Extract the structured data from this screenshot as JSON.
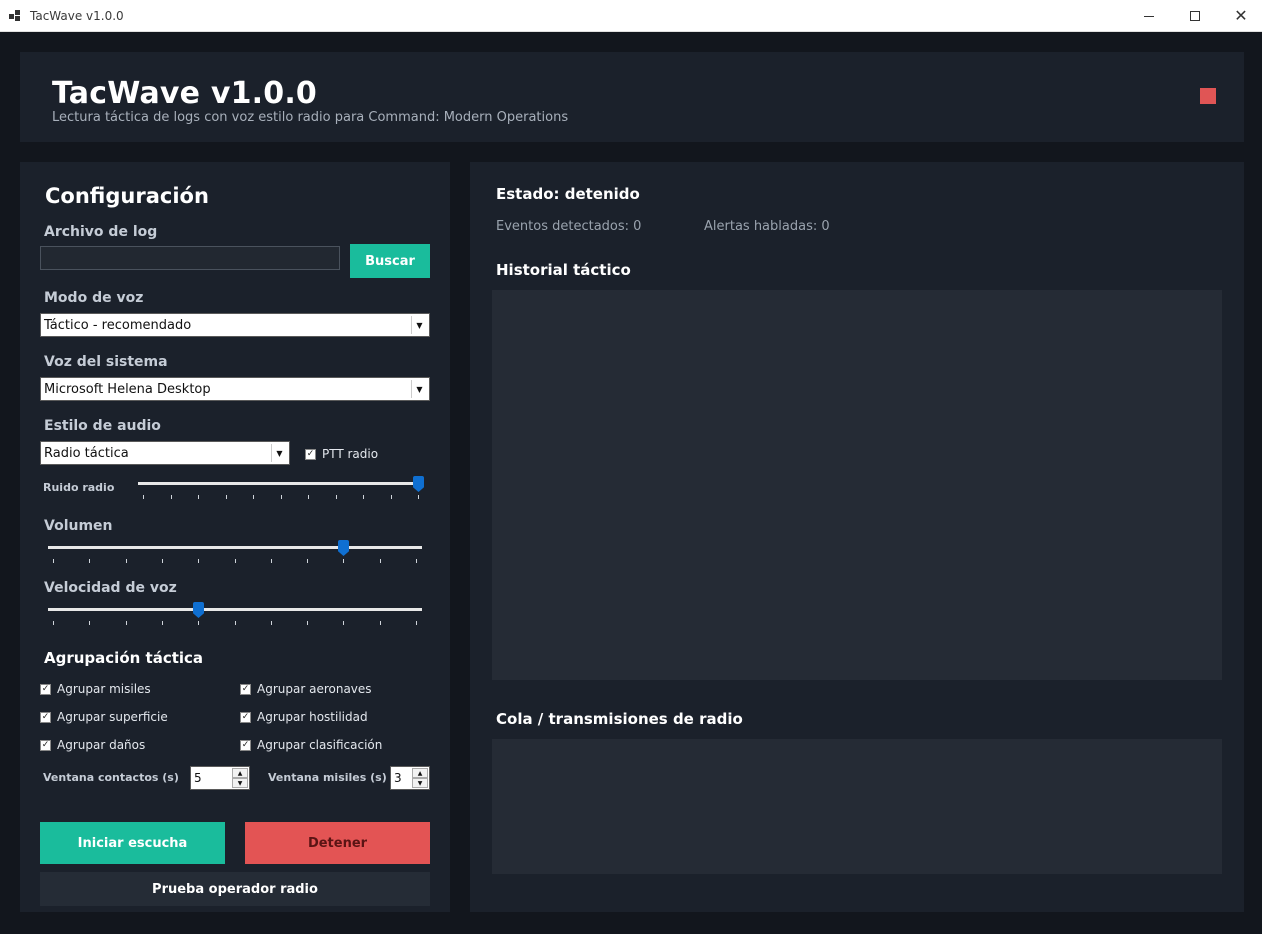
{
  "window": {
    "title": "TacWave v1.0.0"
  },
  "header": {
    "title": "TacWave v1.0.0",
    "subtitle": "Lectura táctica de logs con voz estilo radio para Command: Modern Operations",
    "status_color": "#e05555"
  },
  "config": {
    "heading": "Configuración",
    "log_file": {
      "label": "Archivo de log",
      "value": "",
      "browse_label": "Buscar"
    },
    "voice_mode": {
      "label": "Modo de voz",
      "selected": "Táctico - recomendado"
    },
    "system_voice": {
      "label": "Voz del sistema",
      "selected": "Microsoft Helena Desktop"
    },
    "audio_style": {
      "label": "Estilo de audio",
      "selected": "Radio táctica",
      "ptt_label": "PTT radio",
      "ptt_checked": true
    },
    "radio_noise": {
      "label": "Ruido radio",
      "value": 1.0
    },
    "volume": {
      "label": "Volumen",
      "value": 0.8
    },
    "speech_rate": {
      "label": "Velocidad de voz",
      "value": 0.4
    },
    "grouping": {
      "heading": "Agrupación táctica",
      "options": [
        {
          "label": "Agrupar misiles",
          "checked": true
        },
        {
          "label": "Agrupar aeronaves",
          "checked": true
        },
        {
          "label": "Agrupar superficie",
          "checked": true
        },
        {
          "label": "Agrupar hostilidad",
          "checked": true
        },
        {
          "label": "Agrupar daños",
          "checked": true
        },
        {
          "label": "Agrupar clasificación",
          "checked": true
        }
      ],
      "contacts_window": {
        "label": "Ventana contactos (s)",
        "value": "5"
      },
      "missiles_window": {
        "label": "Ventana misiles (s)",
        "value": "3"
      }
    },
    "buttons": {
      "start": "Iniciar escucha",
      "stop": "Detener",
      "test": "Prueba operador radio"
    }
  },
  "status": {
    "text": "Estado: detenido",
    "events": "Eventos detectados: 0",
    "alerts": "Alertas habladas: 0"
  },
  "history": {
    "heading": "Historial táctico"
  },
  "queue": {
    "heading": "Cola / transmisiones de radio"
  },
  "colors": {
    "accent": "#1abc9c",
    "danger": "#e35454",
    "slider": "#0f6fd1"
  }
}
